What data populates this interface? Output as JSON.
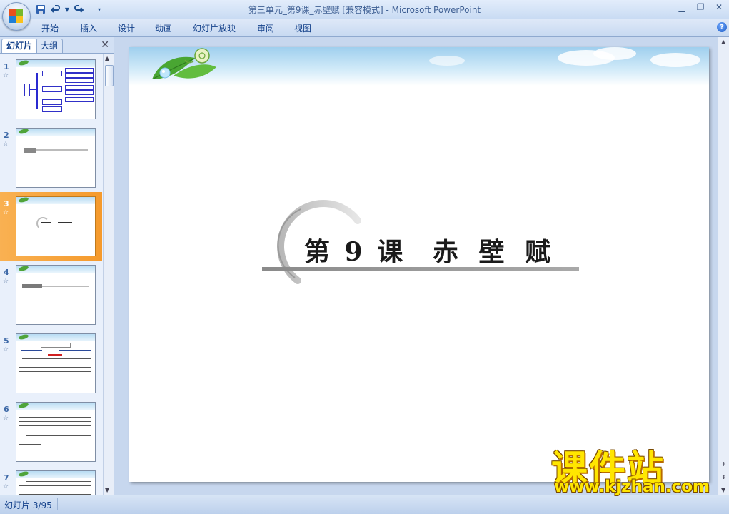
{
  "window": {
    "title": "第三单元_第9课_赤壁赋 [兼容模式] - Microsoft PowerPoint"
  },
  "ribbon": {
    "tabs": [
      "开始",
      "插入",
      "设计",
      "动画",
      "幻灯片放映",
      "审阅",
      "视图"
    ]
  },
  "left_pane": {
    "tab_slides": "幻灯片",
    "tab_outline": "大纲",
    "thumbnails": [
      {
        "num": "1"
      },
      {
        "num": "2"
      },
      {
        "num": "3",
        "selected": true
      },
      {
        "num": "4"
      },
      {
        "num": "5"
      },
      {
        "num": "6"
      },
      {
        "num": "7"
      }
    ]
  },
  "slide": {
    "lesson": "第 9 课",
    "title": "赤 壁 赋"
  },
  "status": {
    "slide_indicator": "幻灯片 3/95"
  },
  "watermark": {
    "brand": "课件站",
    "url": "www.kjzhan.com"
  },
  "colors": {
    "accent": "#15428b",
    "selection": "#f5a33a",
    "watermark": "#ffe600"
  }
}
